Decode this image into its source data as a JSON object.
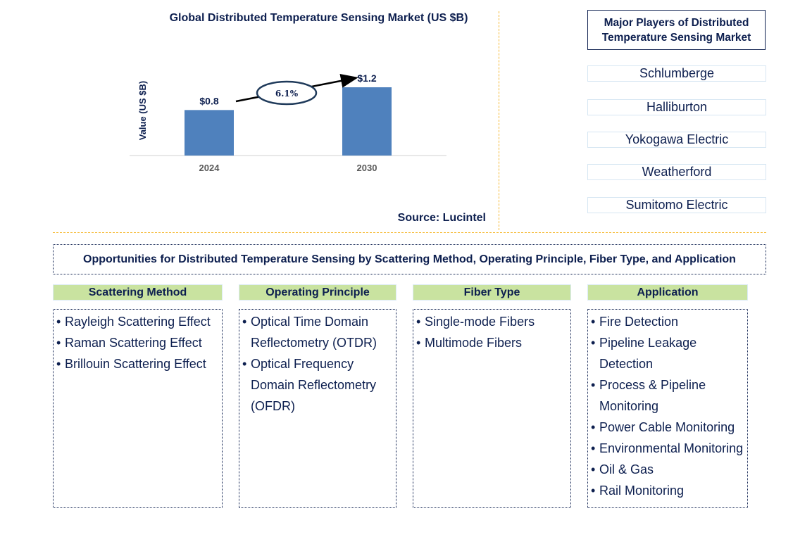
{
  "chart_data": {
    "type": "bar",
    "title": "Global Distributed Temperature Sensing Market (US $B)",
    "xlabel": "",
    "ylabel": "Value (US $B)",
    "categories": [
      "2024",
      "2030"
    ],
    "values": [
      0.8,
      1.2
    ],
    "data_labels": [
      "$0.8",
      "$1.2"
    ],
    "ylim": [
      0,
      1.2
    ],
    "grid": false,
    "bar_color": "#4f81bd",
    "annotation": {
      "type": "cagr-arrow",
      "label": "6.1%",
      "from": "2024",
      "to": "2030"
    }
  },
  "source": "Source: Lucintel",
  "players": {
    "title": "Major Players of Distributed Temperature Sensing Market",
    "items": [
      "Schlumberge",
      "Halliburton",
      "Yokogawa Electric",
      "Weatherford",
      "Sumitomo Electric"
    ]
  },
  "opportunities": {
    "title": "Opportunities for Distributed Temperature Sensing by Scattering Method, Operating Principle, Fiber Type, and Application",
    "categories": [
      {
        "label": "Scattering Method",
        "items": [
          "Rayleigh Scattering Effect",
          "Raman Scattering Effect",
          "Brillouin Scattering Effect"
        ]
      },
      {
        "label": "Operating Principle",
        "items": [
          "Optical Time Domain Reflectometry (OTDR)",
          "Optical Frequency Domain Reflectometry (OFDR)"
        ]
      },
      {
        "label": "Fiber Type",
        "items": [
          "Single-mode Fibers",
          "Multimode Fibers"
        ]
      },
      {
        "label": "Application",
        "items": [
          "Fire Detection",
          "Pipeline Leakage Detection",
          "Process & Pipeline Monitoring",
          "Power Cable Monitoring",
          "Environmental Monitoring",
          "Oil & Gas",
          "Rail Monitoring"
        ]
      }
    ]
  },
  "colors": {
    "text_navy": "#0d1f4f",
    "bar_blue": "#4f81bd",
    "divider_orange": "#f5b82e",
    "header_green": "#c9e3a0"
  }
}
